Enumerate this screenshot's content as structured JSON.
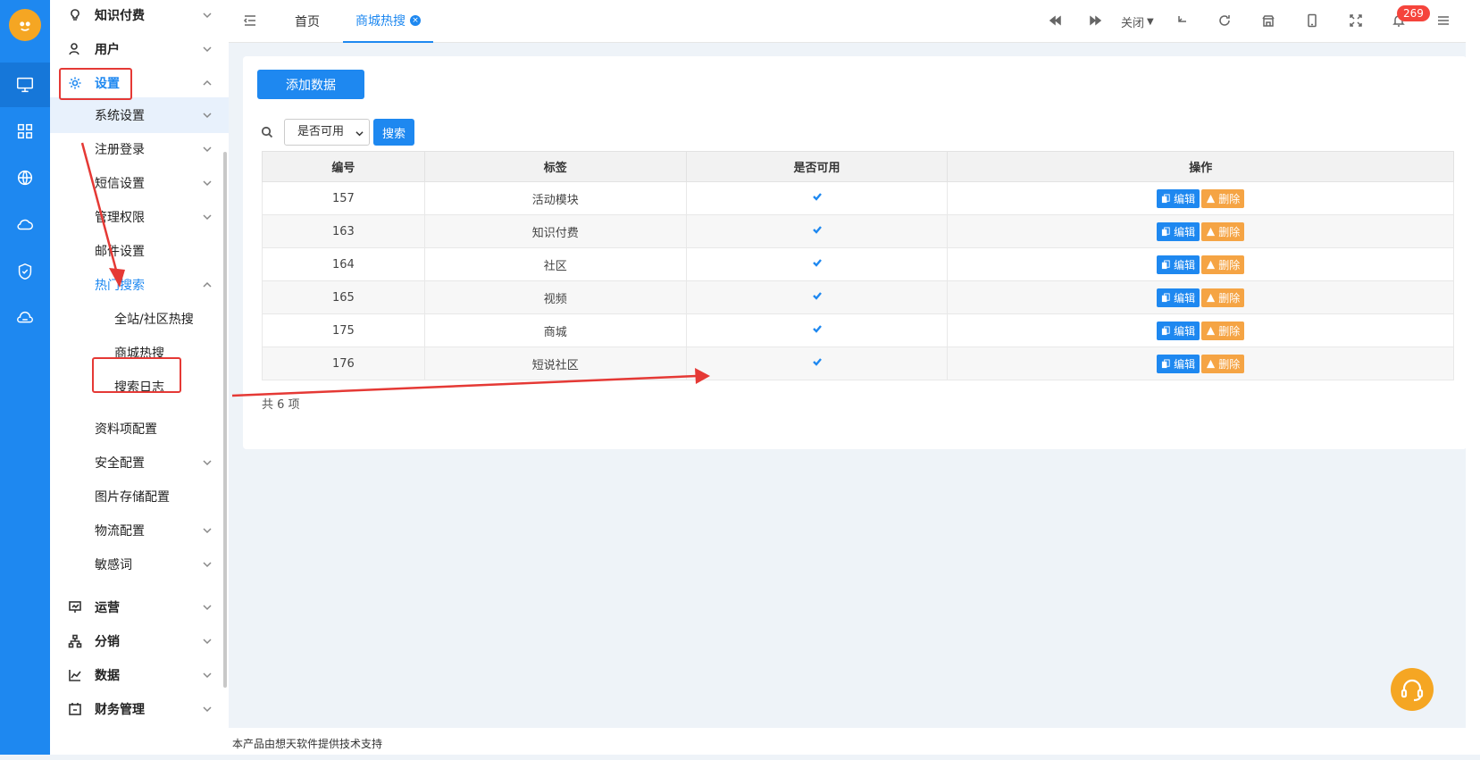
{
  "sidebar": {
    "items": [
      {
        "label": "知识付费"
      },
      {
        "label": "用户"
      },
      {
        "label": "设置"
      },
      {
        "label": "系统设置"
      },
      {
        "label": "注册登录"
      },
      {
        "label": "短信设置"
      },
      {
        "label": "管理权限"
      },
      {
        "label": "邮件设置"
      },
      {
        "label": "热门搜索"
      },
      {
        "label": "全站/社区热搜"
      },
      {
        "label": "商城热搜"
      },
      {
        "label": "搜索日志"
      },
      {
        "label": "资料项配置"
      },
      {
        "label": "安全配置"
      },
      {
        "label": "图片存储配置"
      },
      {
        "label": "物流配置"
      },
      {
        "label": "敏感词"
      },
      {
        "label": "运营"
      },
      {
        "label": "分销"
      },
      {
        "label": "数据"
      },
      {
        "label": "财务管理"
      }
    ]
  },
  "header": {
    "tabs": [
      {
        "label": "首页"
      },
      {
        "label": "商城热搜"
      }
    ],
    "close_label": "关闭",
    "notification_count": "269"
  },
  "toolbar": {
    "add_label": "添加数据",
    "filter_selected": "是否可用",
    "search_label": "搜索"
  },
  "table": {
    "columns": [
      "编号",
      "标签",
      "是否可用",
      "操作"
    ],
    "rows": [
      {
        "id": "157",
        "tag": "活动模块",
        "enabled": true
      },
      {
        "id": "163",
        "tag": "知识付费",
        "enabled": true
      },
      {
        "id": "164",
        "tag": "社区",
        "enabled": true
      },
      {
        "id": "165",
        "tag": "视频",
        "enabled": true
      },
      {
        "id": "175",
        "tag": "商城",
        "enabled": true
      },
      {
        "id": "176",
        "tag": "短说社区",
        "enabled": true
      }
    ],
    "edit_label": "编辑",
    "delete_label": "删除",
    "total_text": "共 6 项"
  },
  "footer": {
    "text": "本产品由想天软件提供技术支持"
  },
  "colors": {
    "accent": "#1e88f0",
    "warning": "#f5a444",
    "annotation": "#e53935"
  }
}
